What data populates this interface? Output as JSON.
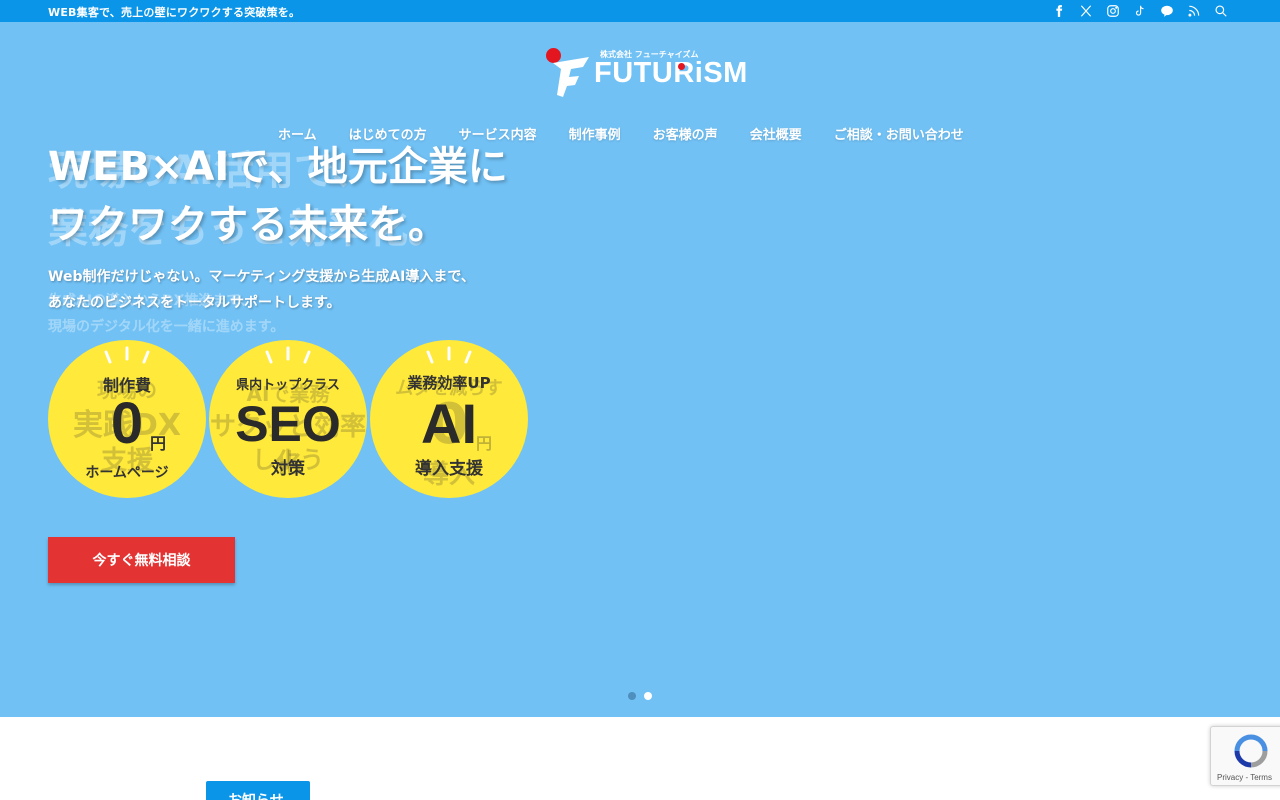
{
  "topbar": {
    "tagline": "WEB集客で、売上の壁にワクワクする突破策を。",
    "icons": [
      "facebook-icon",
      "x-icon",
      "instagram-icon",
      "tiktok-icon",
      "line-icon",
      "rss-icon",
      "search-icon"
    ]
  },
  "logo": {
    "company_small": "株式会社 フューチャイズム",
    "wordmark": "FUTURiSM",
    "accent_color": "#e3151f"
  },
  "nav": {
    "items": [
      "ホーム",
      "はじめての方",
      "サービス内容",
      "制作事例",
      "お客様の声",
      "会社概要",
      "ご相談・お問い合わせ"
    ]
  },
  "hero": {
    "headline_line1": "WEB×AIで、地元企業に",
    "headline_line2": "ワクワクする未来を。",
    "sub_line1": "Web制作だけじゃない。マーケティング支援から生成AI導入まで、",
    "sub_line2": "あなたのビジネスをトータルサポートします。",
    "ghost_line1": "現場のAI活用で、",
    "ghost_line2": "業務をもっと効率化。",
    "ghost_sub1": "生成AIの導入からDX推進まで、",
    "ghost_sub2": "現場のデジタル化を一緒に進めます。",
    "background": "#71c1f5",
    "badges": [
      {
        "top": "制作費",
        "big": "0",
        "unit": "円",
        "bottom": "ホームページ",
        "ghost_a": "現場の",
        "ghost_b": "実践DX",
        "ghost_c": "支援"
      },
      {
        "top": "県内トップクラス",
        "big": "SEO",
        "unit": "",
        "bottom": "対策",
        "ghost_a": "AIで業務",
        "ghost_b": "サクッと効率化",
        "ghost_c": "しよう"
      },
      {
        "top": "業務効率UP",
        "big": "AI",
        "unit": "円",
        "bottom": "導入支援",
        "ghost_a": "ムダを減らす",
        "ghost_b": "0",
        "ghost_c": "導入"
      }
    ],
    "cta_label": "今すぐ無料相談",
    "cta_color": "#e33333"
  },
  "slider": {
    "count": 2,
    "active": 2
  },
  "news": {
    "tab_label": "お知らせ"
  },
  "recaptcha": {
    "terms": "Privacy - Terms"
  }
}
